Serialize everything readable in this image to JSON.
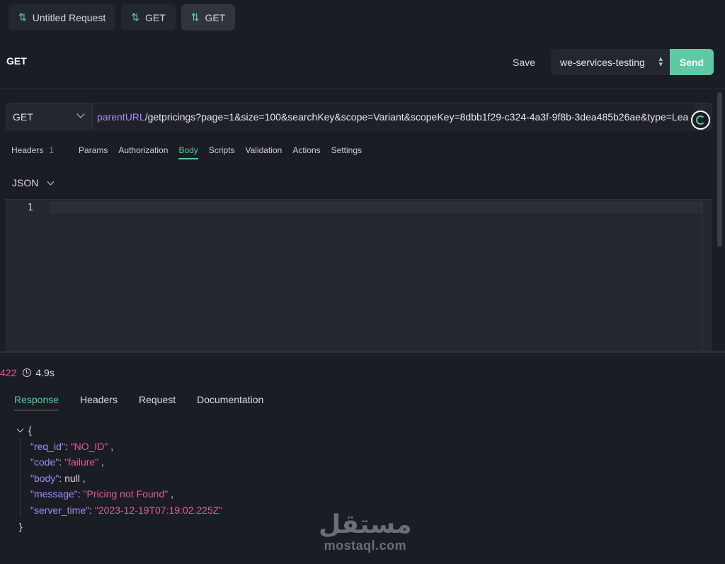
{
  "tabs": [
    {
      "label": "Untitled Request",
      "icon": "swap-vertical-icon"
    },
    {
      "label": "GET",
      "icon": "swap-vertical-icon"
    },
    {
      "label": "GET",
      "icon": "swap-vertical-icon",
      "active": true
    }
  ],
  "header": {
    "title": "GET",
    "save_label": "Save",
    "environment": "we-services-testing",
    "send_label": "Send"
  },
  "request": {
    "method": "GET",
    "url_var": "parentURL",
    "url_rest": "/getpricings?page=1&size=100&searchKey&scope=Variant&scopeKey=8dbb1f29-c324-4a3f-9f8b-3dea485b26ae&type=Lea"
  },
  "subtabs": {
    "headers": "Headers",
    "headers_count": "1",
    "params": "Params",
    "authorization": "Authorization",
    "body": "Body",
    "scripts": "Scripts",
    "validation": "Validation",
    "actions": "Actions",
    "settings": "Settings"
  },
  "body_type": "JSON",
  "editor": {
    "line_number": "1"
  },
  "response": {
    "status_code": "422",
    "time": "4.9s",
    "tabs": {
      "response": "Response",
      "headers": "Headers",
      "request": "Request",
      "documentation": "Documentation"
    },
    "json": {
      "open_brace": "{",
      "close_brace": "}",
      "rows": [
        {
          "key": "\"req_id\"",
          "value": "\"NO_ID\"",
          "type": "string"
        },
        {
          "key": "\"code\"",
          "value": "\"failure\"",
          "type": "string"
        },
        {
          "key": "\"body\"",
          "value": "null",
          "type": "null"
        },
        {
          "key": "\"message\"",
          "value": "\"Pricing not Found\"",
          "type": "string"
        },
        {
          "key": "\"server_time\"",
          "value": "\"2023-12-19T07:19:02.225Z\"",
          "type": "string"
        }
      ]
    }
  },
  "watermark": {
    "arabic": "مستقل",
    "latin": "mostaql.com"
  },
  "colors": {
    "accent": "#5ec9a4",
    "string": "#e05ca0",
    "key": "#a78bfa",
    "background": "#1a1d23"
  }
}
